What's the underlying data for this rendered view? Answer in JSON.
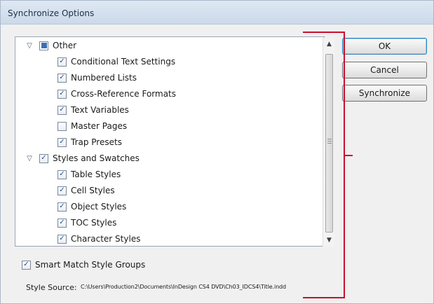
{
  "window": {
    "title": "Synchronize Options"
  },
  "tree": {
    "groups": [
      {
        "label": "Other",
        "state": "partial",
        "items": [
          {
            "label": "Conditional Text Settings",
            "checked": true
          },
          {
            "label": "Numbered Lists",
            "checked": true
          },
          {
            "label": "Cross-Reference Formats",
            "checked": true
          },
          {
            "label": "Text Variables",
            "checked": true
          },
          {
            "label": "Master Pages",
            "checked": false
          },
          {
            "label": "Trap Presets",
            "checked": true
          }
        ]
      },
      {
        "label": "Styles and Swatches",
        "state": "checked",
        "items": [
          {
            "label": "Table Styles",
            "checked": true
          },
          {
            "label": "Cell Styles",
            "checked": true
          },
          {
            "label": "Object Styles",
            "checked": true
          },
          {
            "label": "TOC Styles",
            "checked": true
          },
          {
            "label": "Character Styles",
            "checked": true
          }
        ]
      }
    ]
  },
  "buttons": {
    "ok": "OK",
    "cancel": "Cancel",
    "synchronize": "Synchronize"
  },
  "options": {
    "smart_match_label": "Smart Match Style Groups",
    "smart_match_checked": true
  },
  "style_source": {
    "label": "Style Source:",
    "path": "C:\\Users\\Production2\\Documents\\InDesign CS4 DVD\\Ch03_IDCS4\\Title.indd"
  },
  "colors": {
    "annotation": "#c8102e",
    "default_button_border": "#3c7fb1"
  }
}
